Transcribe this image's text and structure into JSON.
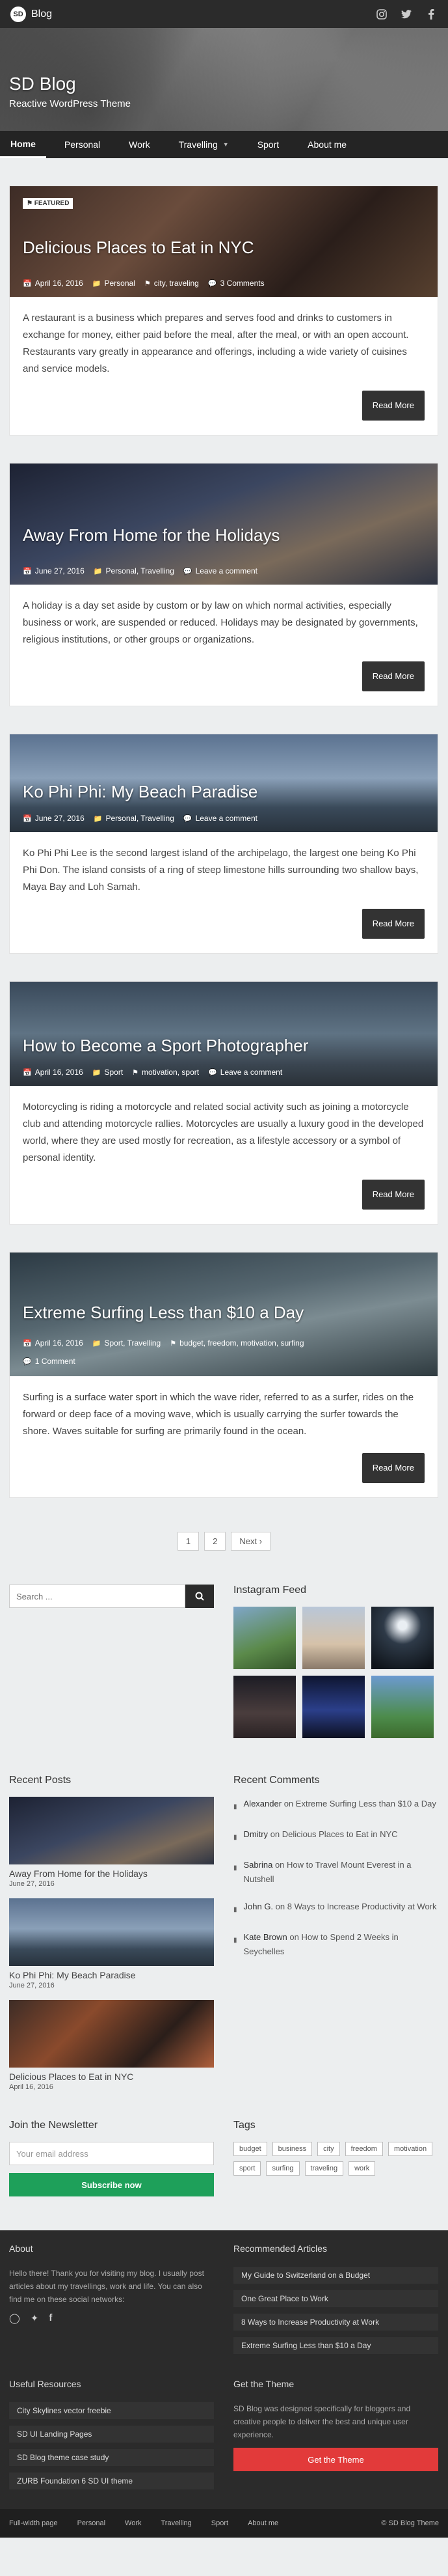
{
  "site": {
    "name": "Blog",
    "badge": "SD",
    "title": "SD Blog",
    "tagline": "Reactive WordPress Theme"
  },
  "top_social": [
    "instagram-icon",
    "twitter-icon",
    "facebook-icon"
  ],
  "nav": [
    {
      "label": "Home",
      "active": true
    },
    {
      "label": "Personal"
    },
    {
      "label": "Work"
    },
    {
      "label": "Travelling",
      "dropdown": true
    },
    {
      "label": "Sport"
    },
    {
      "label": "About me"
    }
  ],
  "featured_label": "FEATURED",
  "posts": [
    {
      "title": "Delicious Places to Eat in NYC",
      "date": "April 16, 2016",
      "categories": "Personal",
      "tags": "city, traveling",
      "comments": "3 Comments",
      "excerpt": "A restaurant is a business which prepares and serves food and drinks to customers in exchange for money, either paid before the meal, after the meal, or with an open account. Restaurants vary greatly in appearance and offerings, including a wide variety of cuisines and service models.",
      "read_more": "Read More"
    },
    {
      "title": "Away From Home for the Holidays",
      "date": "June 27, 2016",
      "categories": "Personal, Travelling",
      "comments": "Leave a comment",
      "excerpt": "A holiday is a day set aside by custom or by law on which normal activities, especially business or work, are suspended or reduced. Holidays may be designated by governments, religious institutions, or other groups or organizations.",
      "read_more": "Read More"
    },
    {
      "title": "Ko Phi Phi: My Beach Paradise",
      "date": "June 27, 2016",
      "categories": "Personal, Travelling",
      "comments": "Leave a comment",
      "excerpt": "Ko Phi Phi Lee is the second largest island of the archipelago, the largest one being Ko Phi Phi Don. The island consists of a ring of steep limestone hills surrounding two shallow bays, Maya Bay and Loh Samah.",
      "read_more": "Read More"
    },
    {
      "title": "How to Become a Sport Photographer",
      "date": "April 16, 2016",
      "categories": "Sport",
      "tags": "motivation, sport",
      "comments": "Leave a comment",
      "excerpt": "Motorcycling is riding a motorcycle and related social activity such as joining a motorcycle club and attending motorcycle rallies. Motorcycles are usually a luxury good in the developed world, where they are used mostly for recreation, as a lifestyle accessory or a symbol of personal identity.",
      "read_more": "Read More"
    },
    {
      "title": "Extreme Surfing Less than $10 a Day",
      "date": "April 16, 2016",
      "categories": "Sport, Travelling",
      "tags": "budget, freedom, motivation, surfing",
      "comments": "1 Comment",
      "excerpt": "Surfing is a surface water sport in which the wave rider, referred to as a surfer, rides on the forward or deep face of a moving wave, which is usually carrying the surfer towards the shore. Waves suitable for surfing are primarily found in the ocean.",
      "read_more": "Read More"
    }
  ],
  "pagination": {
    "pages": [
      "1",
      "2"
    ],
    "next": "Next"
  },
  "search": {
    "placeholder": "Search ..."
  },
  "instagram": {
    "title": "Instagram Feed"
  },
  "recent_posts": {
    "title": "Recent Posts",
    "items": [
      {
        "title": "Away From Home for the Holidays",
        "date": "June 27, 2016"
      },
      {
        "title": "Ko Phi Phi: My Beach Paradise",
        "date": "June 27, 2016"
      },
      {
        "title": "Delicious Places to Eat in NYC",
        "date": "April 16, 2016"
      }
    ]
  },
  "recent_comments": {
    "title": "Recent Comments",
    "items": [
      {
        "author": "Alexander",
        "on": "on",
        "post": "Extreme Surfing Less than $10 a Day"
      },
      {
        "author": "Dmitry",
        "on": "on",
        "post": "Delicious Places to Eat in NYC"
      },
      {
        "author": "Sabrina",
        "on": "on",
        "post": "How to Travel Mount Everest in a Nutshell"
      },
      {
        "author": "John G.",
        "on": "on",
        "post": "8 Ways to Increase Productivity at Work"
      },
      {
        "author": "Kate Brown",
        "on": "on",
        "post": "How to Spend 2 Weeks in Seychelles"
      }
    ]
  },
  "newsletter": {
    "title": "Join the Newsletter",
    "placeholder": "Your email address",
    "button": "Subscribe now"
  },
  "tags": {
    "title": "Tags",
    "items": [
      "budget",
      "business",
      "city",
      "freedom",
      "motivation",
      "sport",
      "surfing",
      "traveling",
      "work"
    ]
  },
  "footer": {
    "about_title": "About",
    "about_text": "Hello there! Thank you for visiting my blog. I usually post articles about my travellings, work and life. You can also find me on these social networks:",
    "recommended_title": "Recommended Articles",
    "recommended": [
      "My Guide to Switzerland on a Budget",
      "One Great Place to Work",
      "8 Ways to Increase Productivity at Work",
      "Extreme Surfing Less than $10 a Day"
    ],
    "resources_title": "Useful Resources",
    "resources": [
      "City Skylines vector freebie",
      "SD UI Landing Pages",
      "SD Blog theme case study",
      "ZURB Foundation 6 SD UI theme"
    ],
    "theme_title": "Get the Theme",
    "theme_text": "SD Blog was designed specifically for bloggers and creative people to deliver the best and unique user experience.",
    "theme_button": "Get the Theme",
    "bottom_nav": [
      "Full-width page",
      "Personal",
      "Work",
      "Travelling",
      "Sport",
      "About me"
    ],
    "copyright": "© SD Blog Theme"
  },
  "colors": {
    "accent_green": "#1ea05a",
    "accent_red": "#e23a3a",
    "dark": "#2b2b2b"
  }
}
